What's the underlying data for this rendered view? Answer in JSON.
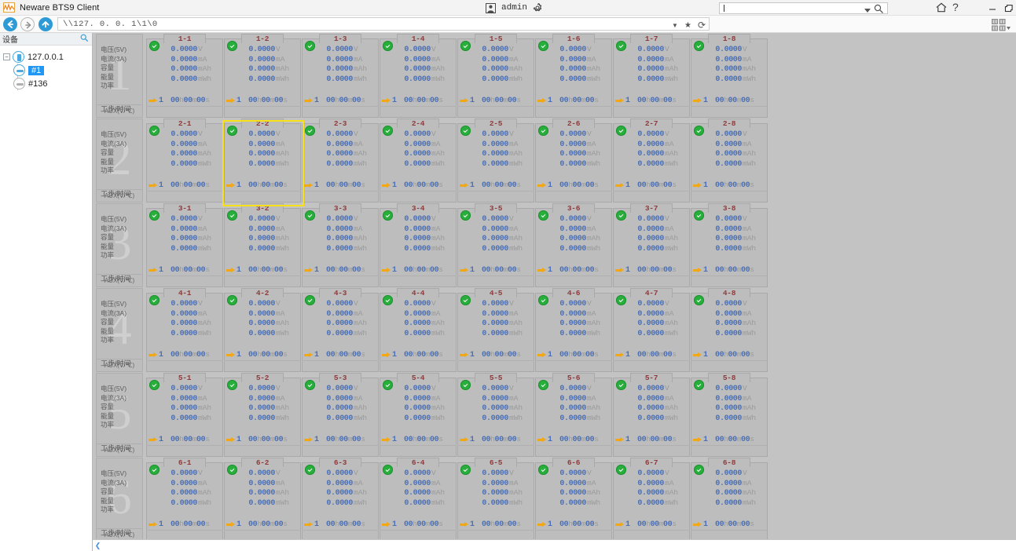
{
  "window": {
    "title": "Neware BTS9 Client",
    "logo_icon": "waveform-logo-icon",
    "minimize_label": "—",
    "maximize_label": "❐"
  },
  "titlebar": {
    "user_icon": "user-avatar-icon",
    "user_name": "admin",
    "settings_icon": "gear-icon",
    "search": {
      "value": "",
      "placeholder": "",
      "dropdown_icon": "chevron-down-icon",
      "search_icon": "magnifier-icon"
    },
    "home_icon": "home-icon",
    "help_icon": "?"
  },
  "navbar": {
    "back_icon": "arrow-left-icon",
    "forward_icon": "arrow-right-icon",
    "up_icon": "arrow-up-icon",
    "address_value": "\\\\127. 0. 0. 1\\1\\0",
    "dropdown_icon": "▼",
    "favorite_icon": "★",
    "refresh_icon": "⟳",
    "gridview_icon": "grid-view-icon"
  },
  "sidebar": {
    "header_title": "设备",
    "search_icon": "magnifier-icon",
    "tree": [
      {
        "label": "127.0.0.1",
        "level": 0,
        "icon": "device-icon",
        "selected": false,
        "expander": "−"
      },
      {
        "label": "#1",
        "level": 1,
        "icon": "channel-icon",
        "selected": true
      },
      {
        "label": "#136",
        "level": 1,
        "icon": "channel-icon-gray",
        "selected": false
      }
    ]
  },
  "grid": {
    "row_labels": [
      "电压(5V)",
      "电流(3A)",
      "容量",
      "能量",
      "功率"
    ],
    "step_label": "工步/时间",
    "aux_label": "AUX(V/℃)",
    "rows": [
      "1",
      "2",
      "3",
      "4",
      "5",
      "6"
    ],
    "columns": [
      "1",
      "2",
      "3",
      "4",
      "5",
      "6",
      "7",
      "8"
    ],
    "selected_cell": "2-2",
    "cell_template": {
      "status": "ok",
      "status_icon": "check-circle-icon",
      "values": [
        {
          "num": "0.0000",
          "unit": "V"
        },
        {
          "num": "0.0000",
          "unit": "mA"
        },
        {
          "num": "0.0000",
          "unit": "mAh"
        },
        {
          "num": "0.0000",
          "unit": "mWh"
        }
      ],
      "step_icon": "arrow-right-icon",
      "step_no": "1",
      "time": {
        "h": "00",
        "hu": "h",
        "m": "00",
        "mu": "m",
        "s": "00",
        "su": "s"
      }
    }
  },
  "scrollbar": {
    "left_arrow": "❮"
  },
  "colors": {
    "accent_blue": "#2e9bd6",
    "value_blue": "#4a6fb5",
    "unit_gray": "#9a9a9a",
    "cell_label_red": "#8d3b3b",
    "status_green": "#27ae3b",
    "arrow_orange": "#f2a714",
    "selection_yellow": "#f7e018",
    "panel_gray": "#bdbdbd",
    "tree_select_blue": "#2196f3"
  }
}
